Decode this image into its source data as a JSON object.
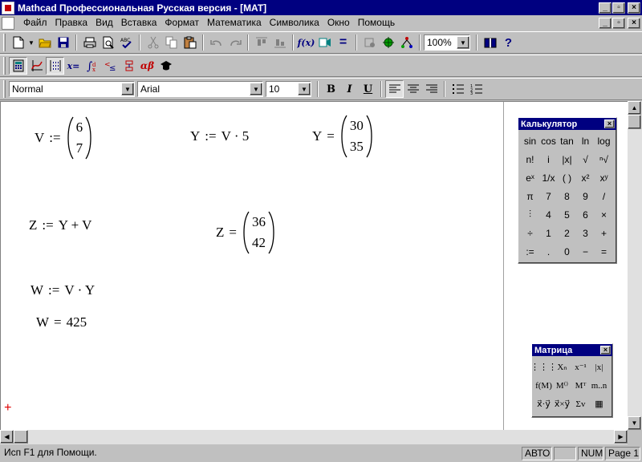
{
  "window": {
    "title": "Mathcad Профессиональная Русская версия - [MAT]",
    "caption_buttons": [
      "_",
      "▫",
      "×"
    ]
  },
  "menu": [
    "Файл",
    "Правка",
    "Вид",
    "Вставка",
    "Формат",
    "Математика",
    "Символика",
    "Окно",
    "Помощь"
  ],
  "toolbar_standard": {
    "zoom": "100%",
    "fx_label": "f(x)"
  },
  "toolbar_math": {
    "alpha_beta": "αβ",
    "xeq": "x="
  },
  "toolbar_format": {
    "style": "Normal",
    "font": "Arial",
    "size": "10",
    "bold": "B",
    "italic": "I",
    "underline": "U"
  },
  "worksheet": {
    "v_def": {
      "lhs": "V",
      "op": ":=",
      "values": [
        "6",
        "7"
      ]
    },
    "y_def": {
      "lhs": "Y",
      "op": ":=",
      "rhs": "V · 5"
    },
    "y_eval": {
      "lhs": "Y",
      "op": "=",
      "values": [
        "30",
        "35"
      ]
    },
    "z_def": {
      "lhs": "Z",
      "op": ":=",
      "rhs": "Y + V"
    },
    "z_eval": {
      "lhs": "Z",
      "op": "=",
      "values": [
        "36",
        "42"
      ]
    },
    "w_def": {
      "lhs": "W",
      "op": ":=",
      "rhs": "V · Y"
    },
    "w_eval": {
      "lhs": "W",
      "op": "=",
      "rhs": "425"
    },
    "cursor": "+"
  },
  "calculator": {
    "title": "Калькулятор",
    "close": "×",
    "keys": [
      "sin",
      "cos",
      "tan",
      "ln",
      "log",
      "n!",
      "i",
      "|x|",
      "√",
      "ⁿ√",
      "eˣ",
      "1/x",
      "( )",
      "x²",
      "xʸ",
      "π",
      "7",
      "8",
      "9",
      "/",
      "⫶",
      "4",
      "5",
      "6",
      "×",
      "÷",
      "1",
      "2",
      "3",
      "+",
      ":=",
      ".",
      "0",
      "−",
      "="
    ]
  },
  "matrix_palette": {
    "title": "Матрица",
    "close": "×",
    "keys": [
      "⋮⋮⋮",
      "Xₙ",
      "x⁻¹",
      "|x|",
      "f(M)",
      "M⁽⁾",
      "Mᵀ",
      "m..n",
      "x⃗·y⃗",
      "x⃗×y⃗",
      "Σv",
      "▦"
    ]
  },
  "status": {
    "help": "Исп F1 для Помощи.",
    "mode": "АВТО",
    "blank": "",
    "num": "NUM",
    "page": "Page 1"
  }
}
